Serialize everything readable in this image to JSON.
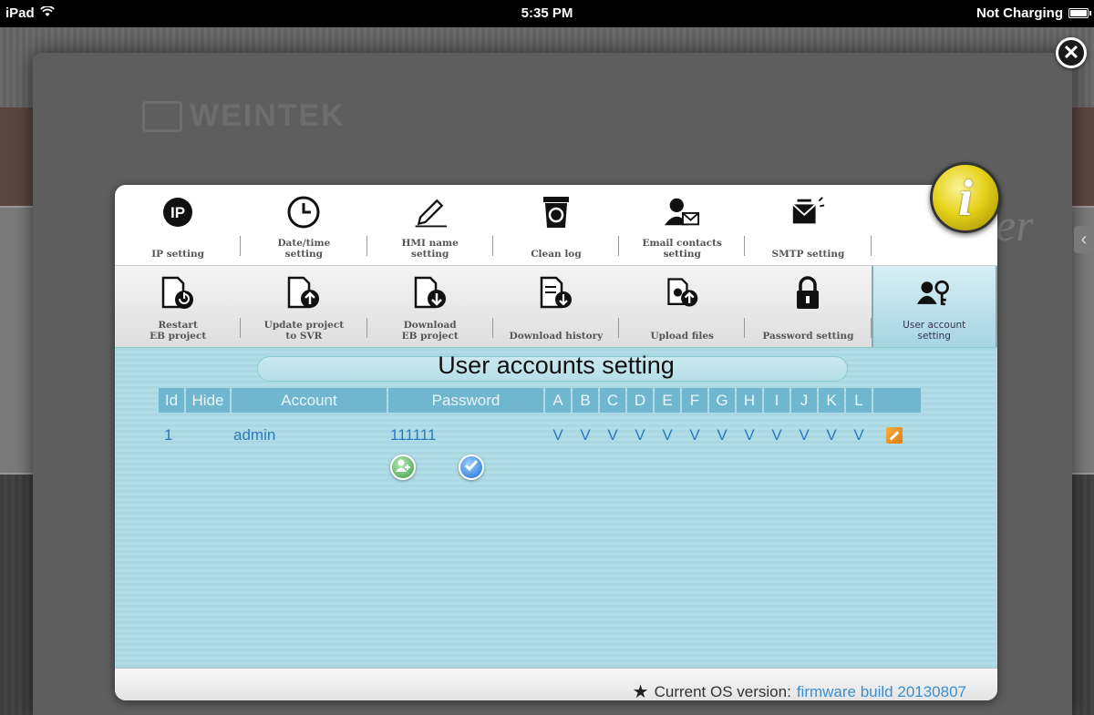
{
  "statusbar": {
    "device": "iPad",
    "time": "5:35 PM",
    "battery_text": "Not Charging"
  },
  "background": {
    "logo_text": "WEINTEK",
    "partial_text": "er"
  },
  "toolbar_row1": [
    {
      "label": "IP setting",
      "icon": "ip-icon"
    },
    {
      "label": "Date/time\nsetting",
      "icon": "clock-icon"
    },
    {
      "label": "HMI name\nsetting",
      "icon": "pen-icon"
    },
    {
      "label": "Clean log",
      "icon": "recycle-bin-icon"
    },
    {
      "label": "Email contacts\nsetting",
      "icon": "contact-mail-icon"
    },
    {
      "label": "SMTP setting",
      "icon": "mail-send-icon"
    },
    {
      "label": "",
      "icon": "info-icon"
    }
  ],
  "toolbar_row2": [
    {
      "label": "Restart\nEB project",
      "icon": "restart-document-icon"
    },
    {
      "label": "Update project\nto SVR",
      "icon": "upload-document-icon"
    },
    {
      "label": "Download\nEB project",
      "icon": "download-document-icon"
    },
    {
      "label": "Download history",
      "icon": "history-download-icon"
    },
    {
      "label": "Upload files",
      "icon": "upload-files-icon"
    },
    {
      "label": "Password setting",
      "icon": "lock-icon"
    },
    {
      "label": "User account\nsetting",
      "icon": "users-key-icon"
    }
  ],
  "content": {
    "title": "User accounts setting",
    "columns": [
      "Id",
      "Hide",
      "Account",
      "Password",
      "A",
      "B",
      "C",
      "D",
      "E",
      "F",
      "G",
      "H",
      "I",
      "J",
      "K",
      "L",
      ""
    ],
    "rows": [
      {
        "id": "1",
        "hide": "",
        "account": "admin",
        "password": "111111",
        "perms": [
          "V",
          "V",
          "V",
          "V",
          "V",
          "V",
          "V",
          "V",
          "V",
          "V",
          "V",
          "V"
        ]
      }
    ]
  },
  "footer": {
    "label": "Current OS version:",
    "version": "firmware build 20130807"
  },
  "colors": {
    "accent": "#6fb6cf",
    "content_bg": "#aedbe4",
    "link": "#2a79c0"
  }
}
